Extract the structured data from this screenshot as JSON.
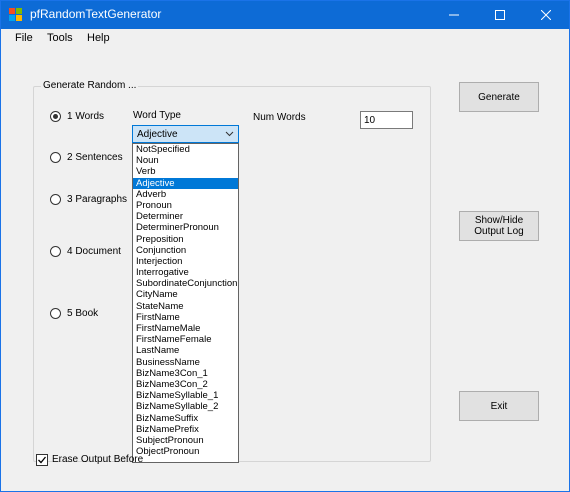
{
  "window": {
    "title": "pfRandomTextGenerator"
  },
  "menu": [
    "File",
    "Tools",
    "Help"
  ],
  "group": {
    "title": "Generate Random ...",
    "options": [
      {
        "label": "1 Words",
        "selected": true
      },
      {
        "label": "2 Sentences",
        "selected": false
      },
      {
        "label": "3 Paragraphs",
        "selected": false
      },
      {
        "label": "4 Document",
        "selected": false
      },
      {
        "label": "5 Book",
        "selected": false
      }
    ]
  },
  "word_type": {
    "label": "Word Type",
    "selected": "Adjective",
    "options": [
      "NotSpecified",
      "Noun",
      "Verb",
      "Adjective",
      "Adverb",
      "Pronoun",
      "Determiner",
      "DeterminerPronoun",
      "Preposition",
      "Conjunction",
      "Interjection",
      "Interrogative",
      "SubordinateConjunction",
      "CityName",
      "StateName",
      "FirstName",
      "FirstNameMale",
      "FirstNameFemale",
      "LastName",
      "BusinessName",
      "BizName3Con_1",
      "BizName3Con_2",
      "BizNameSyllable_1",
      "BizNameSyllable_2",
      "BizNameSuffix",
      "BizNamePrefix",
      "SubjectPronoun",
      "ObjectPronoun"
    ]
  },
  "num_words": {
    "label": "Num Words",
    "value": "10"
  },
  "buttons": {
    "generate": "Generate",
    "show_hide": "Show/Hide\nOutput Log",
    "exit": "Exit"
  },
  "erase_output": {
    "label": "Erase Output Before",
    "checked": true
  },
  "colors": {
    "titlebar": "#0d6bd6",
    "selection": "#0078d7",
    "combo_bg": "#cce4f7"
  }
}
